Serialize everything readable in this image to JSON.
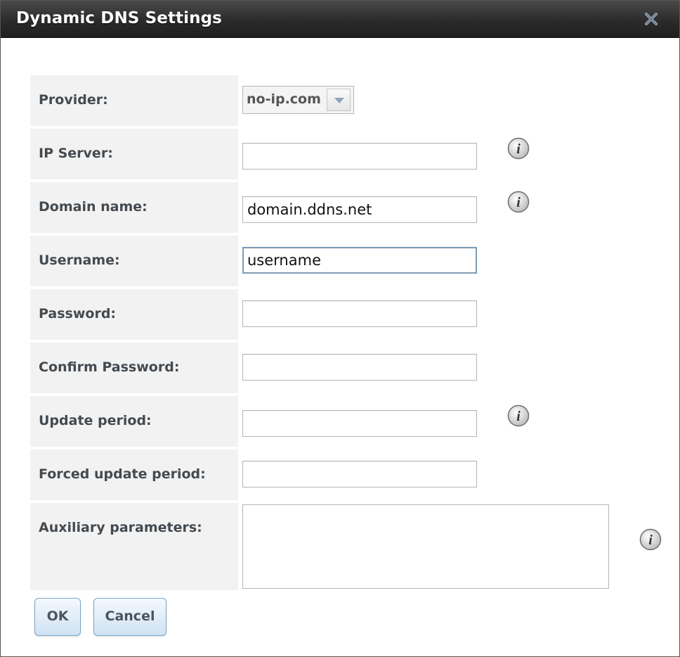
{
  "dialog": {
    "title": "Dynamic DNS Settings",
    "close_icon": "close-icon"
  },
  "fields": {
    "provider": {
      "label": "Provider:",
      "value": "no-ip.com"
    },
    "ip_server": {
      "label": "IP Server:",
      "value": "",
      "info_icon": "info-icon"
    },
    "domain_name": {
      "label": "Domain name:",
      "value": "domain.ddns.net",
      "info_icon": "info-icon"
    },
    "username": {
      "label": "Username:",
      "value": "username"
    },
    "password": {
      "label": "Password:",
      "value": ""
    },
    "confirm_password": {
      "label": "Confirm Password:",
      "value": ""
    },
    "update_period": {
      "label": "Update period:",
      "value": "",
      "info_icon": "info-icon"
    },
    "forced_update_period": {
      "label": "Forced update period:",
      "value": ""
    },
    "auxiliary_parameters": {
      "label": "Auxiliary parameters:",
      "value": "",
      "info_icon": "info-icon"
    }
  },
  "buttons": {
    "ok": "OK",
    "cancel": "Cancel"
  },
  "colors": {
    "title_bar": "#2b2b2b",
    "label_bg": "#f2f2f2",
    "button_border": "#7fa6c8",
    "focus_border": "#7d9db8"
  }
}
